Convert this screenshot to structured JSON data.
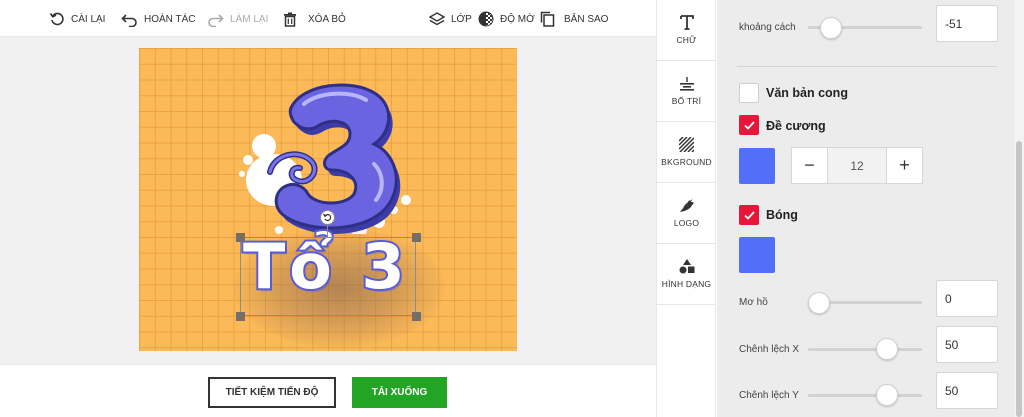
{
  "toolbar": {
    "reset_label": "CÀI LẠI",
    "undo_label": "HOÀN TÁC",
    "redo_label": "LÀM LẠI",
    "delete_label": "XÓA BỎ",
    "layer_label": "LỚP",
    "opacity_label": "ĐỘ MỜ",
    "copy_label": "BẢN SAO"
  },
  "canvas": {
    "background_color": "#fbb957",
    "text": "Tổ 3",
    "logo_text": "3",
    "logo_color": "#5a5bd8"
  },
  "bottom": {
    "save_label": "TIẾT KIỆM TIẾN ĐỘ",
    "download_label": "TẢI XUỐNG",
    "download_color": "#22a524"
  },
  "side_tabs": [
    {
      "label": "CHỮ",
      "icon": "text-icon"
    },
    {
      "label": "BỐ TRÍ",
      "icon": "align-icon"
    },
    {
      "label": "BKGROUND",
      "icon": "hatch-icon"
    },
    {
      "label": "LOGO",
      "icon": "bird-icon"
    },
    {
      "label": "HÌNH DẠNG",
      "icon": "shapes-icon"
    }
  ],
  "panel": {
    "spacing_label": "khoảng cách",
    "spacing_value": "-51",
    "spacing_level": 0.15,
    "curved_label": "Văn bản cong",
    "curved_checked": false,
    "outline_label": "Đề cương",
    "outline_checked": true,
    "outline_color": "#5270f7",
    "outline_width": "12",
    "stepper_minus": "−",
    "stepper_plus": "+",
    "shadow_label": "Bóng",
    "shadow_checked": true,
    "shadow_color": "#5270f7",
    "blur_label": "Mơ hồ",
    "blur_value": "0",
    "blur_level": 0.0,
    "offset_x_label": "Chênh lệch X",
    "offset_x_value": "50",
    "offset_x_level": 0.7,
    "offset_y_label": "Chênh lệch Y",
    "offset_y_value": "50",
    "offset_y_level": 0.7,
    "accent_color": "#e8163b"
  }
}
